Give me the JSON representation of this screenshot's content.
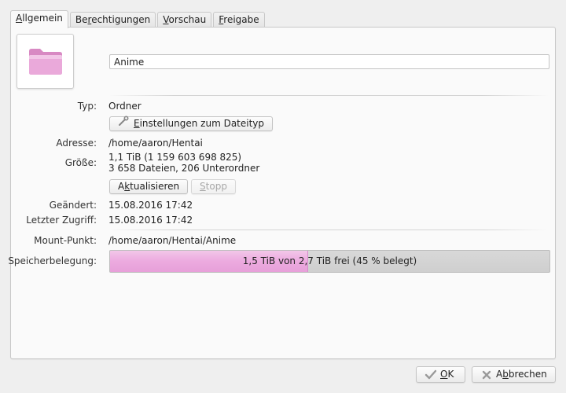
{
  "tabs": [
    {
      "label_u": "A",
      "label_rest": "llgemein",
      "active": true
    },
    {
      "label_pre": "Be",
      "label_u": "r",
      "label_rest": "echtigungen"
    },
    {
      "label_u": "V",
      "label_rest": "orschau"
    },
    {
      "label_u": "F",
      "label_rest": "reigabe"
    }
  ],
  "name": {
    "value": "Anime"
  },
  "folder_icon": {
    "name": "folder-icon",
    "color": "#e9a3d6"
  },
  "fields": {
    "type_label": "Typ:",
    "type_value": "Ordner",
    "filetype_button_u": "E",
    "filetype_button_rest": "instellungen zum Dateityp",
    "address_label": "Adresse:",
    "address_value": "/home/aaron/Hentai",
    "size_label": "Größe:",
    "size_line1": "1,1 TiB (1 159 603 698 825)",
    "size_line2": "3 658 Dateien, 206 Unterordner",
    "refresh_button_pre": "A",
    "refresh_button_u": "k",
    "refresh_button_rest": "tualisieren",
    "stop_button_u": "S",
    "stop_button_rest": "topp",
    "modified_label": "Geändert:",
    "modified_value": "15.08.2016 17:42",
    "accessed_label": "Letzter Zugriff:",
    "accessed_value": "15.08.2016 17:42",
    "mount_label": "Mount-Punkt:",
    "mount_value": "/home/aaron/Hentai/Anime",
    "usage_label": "Speicherbelegung:",
    "usage_text": "1,5 TiB von 2,7 TiB frei (45 % belegt)",
    "usage_fraction": 0.45
  },
  "buttons": {
    "ok_u": "O",
    "ok_rest": "K",
    "cancel_u": "b",
    "cancel_pre": "A",
    "cancel_rest": "brechen"
  },
  "colors": {
    "accent": "#e9a3d6",
    "bar_bg": "#d2d2d2"
  }
}
